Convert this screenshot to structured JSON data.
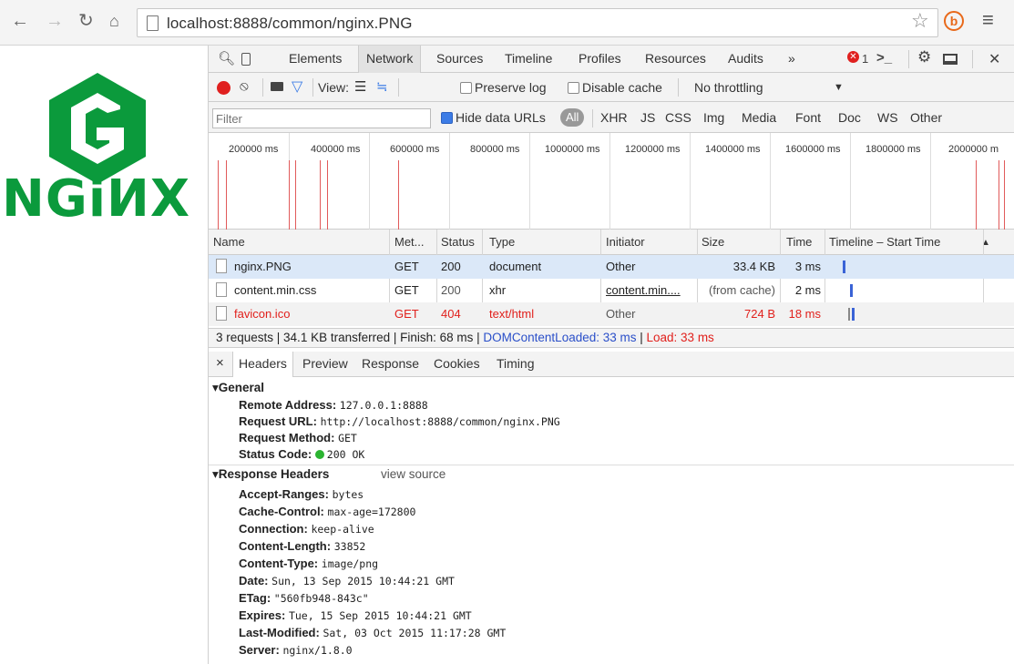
{
  "browser": {
    "url": "localhost:8888/common/nginx.PNG",
    "back_icon": "back-arrow-icon",
    "forward_icon": "forward-arrow-icon",
    "reload_icon": "reload-icon",
    "home_icon": "home-icon"
  },
  "page": {
    "logo_text": "NGiИX",
    "logo_color": "#0b9a3c"
  },
  "devtools": {
    "tabs": [
      "Elements",
      "Network",
      "Sources",
      "Timeline",
      "Profiles",
      "Resources",
      "Audits",
      "»"
    ],
    "active_tab": "Network",
    "error_count": "1",
    "toolbar": {
      "view_label": "View:",
      "preserve_log": "Preserve log",
      "disable_cache": "Disable cache",
      "throttling": "No throttling"
    },
    "filter": {
      "placeholder": "Filter",
      "hide_data_urls": "Hide data URLs",
      "types": [
        "All",
        "XHR",
        "JS",
        "CSS",
        "Img",
        "Media",
        "Font",
        "Doc",
        "WS",
        "Other"
      ]
    },
    "overview_ticks": [
      "200000 ms",
      "400000 ms",
      "600000 ms",
      "800000 ms",
      "1000000 ms",
      "1200000 ms",
      "1400000 ms",
      "1600000 ms",
      "1800000 ms",
      "2000000 m"
    ],
    "columns": [
      "Name",
      "Met...",
      "Status",
      "Type",
      "Initiator",
      "Size",
      "Time",
      "Timeline – Start Time"
    ],
    "sort_indicator": "▲",
    "requests": [
      {
        "name": "nginx.PNG",
        "method": "GET",
        "status": "200",
        "type": "document",
        "initiator": "Other",
        "size": "33.4 KB",
        "time": "3 ms"
      },
      {
        "name": "content.min.css",
        "method": "GET",
        "status": "200",
        "type": "xhr",
        "initiator": "content.min....",
        "size": "(from cache)",
        "time": "2 ms"
      },
      {
        "name": "favicon.ico",
        "method": "GET",
        "status": "404",
        "type": "text/html",
        "initiator": "Other",
        "size": "724 B",
        "time": "18 ms"
      }
    ],
    "summary": {
      "text": "3 requests | 34.1 KB transferred | Finish: 68 ms | ",
      "dom": "DOMContentLoaded: 33 ms",
      "sep": " | ",
      "load": "Load: 33 ms"
    },
    "detail_tabs": [
      "Headers",
      "Preview",
      "Response",
      "Cookies",
      "Timing"
    ],
    "detail_close": "×",
    "general": {
      "title": "General",
      "remote_address_k": "Remote Address:",
      "remote_address_v": "127.0.0.1:8888",
      "request_url_k": "Request URL:",
      "request_url_v": "http://localhost:8888/common/nginx.PNG",
      "request_method_k": "Request Method:",
      "request_method_v": "GET",
      "status_code_k": "Status Code:",
      "status_code_v": "200 OK"
    },
    "response_headers": {
      "title": "Response Headers",
      "view_source": "view source",
      "items": [
        {
          "k": "Accept-Ranges:",
          "v": "bytes"
        },
        {
          "k": "Cache-Control:",
          "v": "max-age=172800"
        },
        {
          "k": "Connection:",
          "v": "keep-alive"
        },
        {
          "k": "Content-Length:",
          "v": "33852"
        },
        {
          "k": "Content-Type:",
          "v": "image/png"
        },
        {
          "k": "Date:",
          "v": "Sun, 13 Sep 2015 10:44:21 GMT"
        },
        {
          "k": "ETag:",
          "v": "\"560fb948-843c\""
        },
        {
          "k": "Expires:",
          "v": "Tue, 15 Sep 2015 10:44:21 GMT"
        },
        {
          "k": "Last-Modified:",
          "v": "Sat, 03 Oct 2015 11:17:28 GMT"
        },
        {
          "k": "Server:",
          "v": "nginx/1.8.0"
        }
      ]
    }
  }
}
